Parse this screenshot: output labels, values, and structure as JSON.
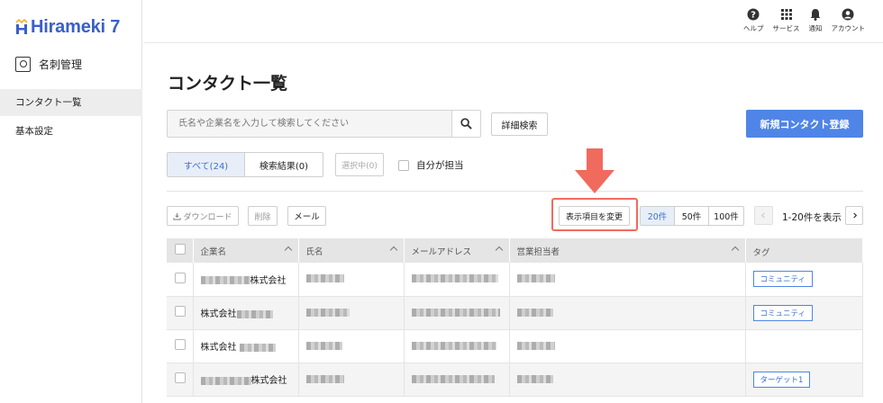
{
  "app": {
    "logo_text": "Hirameki 7"
  },
  "sidebar": {
    "section_title": "名刺管理",
    "items": [
      {
        "label": "コンタクト一覧",
        "active": true
      },
      {
        "label": "基本設定",
        "active": false
      }
    ]
  },
  "topbar": {
    "items": [
      {
        "label": "ヘルプ",
        "icon": "help-icon"
      },
      {
        "label": "サービス",
        "icon": "grid-icon"
      },
      {
        "label": "通知",
        "icon": "bell-icon"
      },
      {
        "label": "アカウント",
        "icon": "account-icon"
      }
    ]
  },
  "page": {
    "title": "コンタクト一覧"
  },
  "search": {
    "placeholder": "氏名や企業名を入力して検索してください",
    "value": "",
    "advanced_label": "詳細検索"
  },
  "new_contact_label": "新規コンタクト登録",
  "filters": {
    "tab_all": "すべて(24)",
    "tab_results": "検索結果(0)",
    "selected": "選択中(0)",
    "mine_label": "自分が担当"
  },
  "toolbar": {
    "download": "ダウンロード",
    "delete": "削除",
    "mail": "メール",
    "columns": "表示項目を変更",
    "page_sizes": [
      "20件",
      "50件",
      "100件"
    ],
    "range": "1-20件を表示"
  },
  "table": {
    "headers": [
      "企業名",
      "氏名",
      "メールアドレス",
      "営業担当者",
      "タグ"
    ],
    "rows": [
      {
        "company_suffix": "株式会社",
        "tag": "コミュニティ"
      },
      {
        "company_prefix": "株式会社",
        "tag": "コミュニティ"
      },
      {
        "company_prefix": "株式会社",
        "tag": ""
      },
      {
        "company_suffix": "株式会社",
        "tag": "ターゲット1"
      }
    ]
  },
  "colors": {
    "accent": "#4f85e6",
    "highlight": "#f06b5e",
    "logo": "#3a5fc8"
  }
}
